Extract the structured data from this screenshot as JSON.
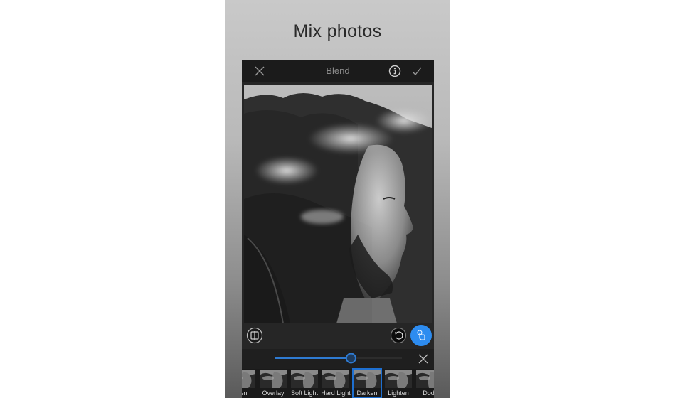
{
  "promo": {
    "title": "Mix photos"
  },
  "header": {
    "title": "Blend",
    "close_icon": "close-icon",
    "info_icon": "info-icon",
    "confirm_icon": "checkmark-icon"
  },
  "photo": {
    "description": "Black-and-white double exposure: bald bearded man in profile blended with foggy forest"
  },
  "toolbar": {
    "compare_icon": "compare-split-icon",
    "undo_icon": "undo-icon",
    "touch_icon": "touch-brush-icon",
    "accent_color": "#2d8cf0"
  },
  "slider": {
    "value_fraction": 0.6,
    "track_color": "#2e7ad1",
    "close_icon": "close-icon"
  },
  "blend_modes": {
    "items": [
      {
        "label": "een",
        "selected": false
      },
      {
        "label": "Overlay",
        "selected": false
      },
      {
        "label": "Soft Light",
        "selected": false
      },
      {
        "label": "Hard Light",
        "selected": false
      },
      {
        "label": "Darken",
        "selected": true
      },
      {
        "label": "Lighten",
        "selected": false
      },
      {
        "label": "Dod-",
        "selected": false
      }
    ],
    "selected_color": "#1e6fd0"
  }
}
